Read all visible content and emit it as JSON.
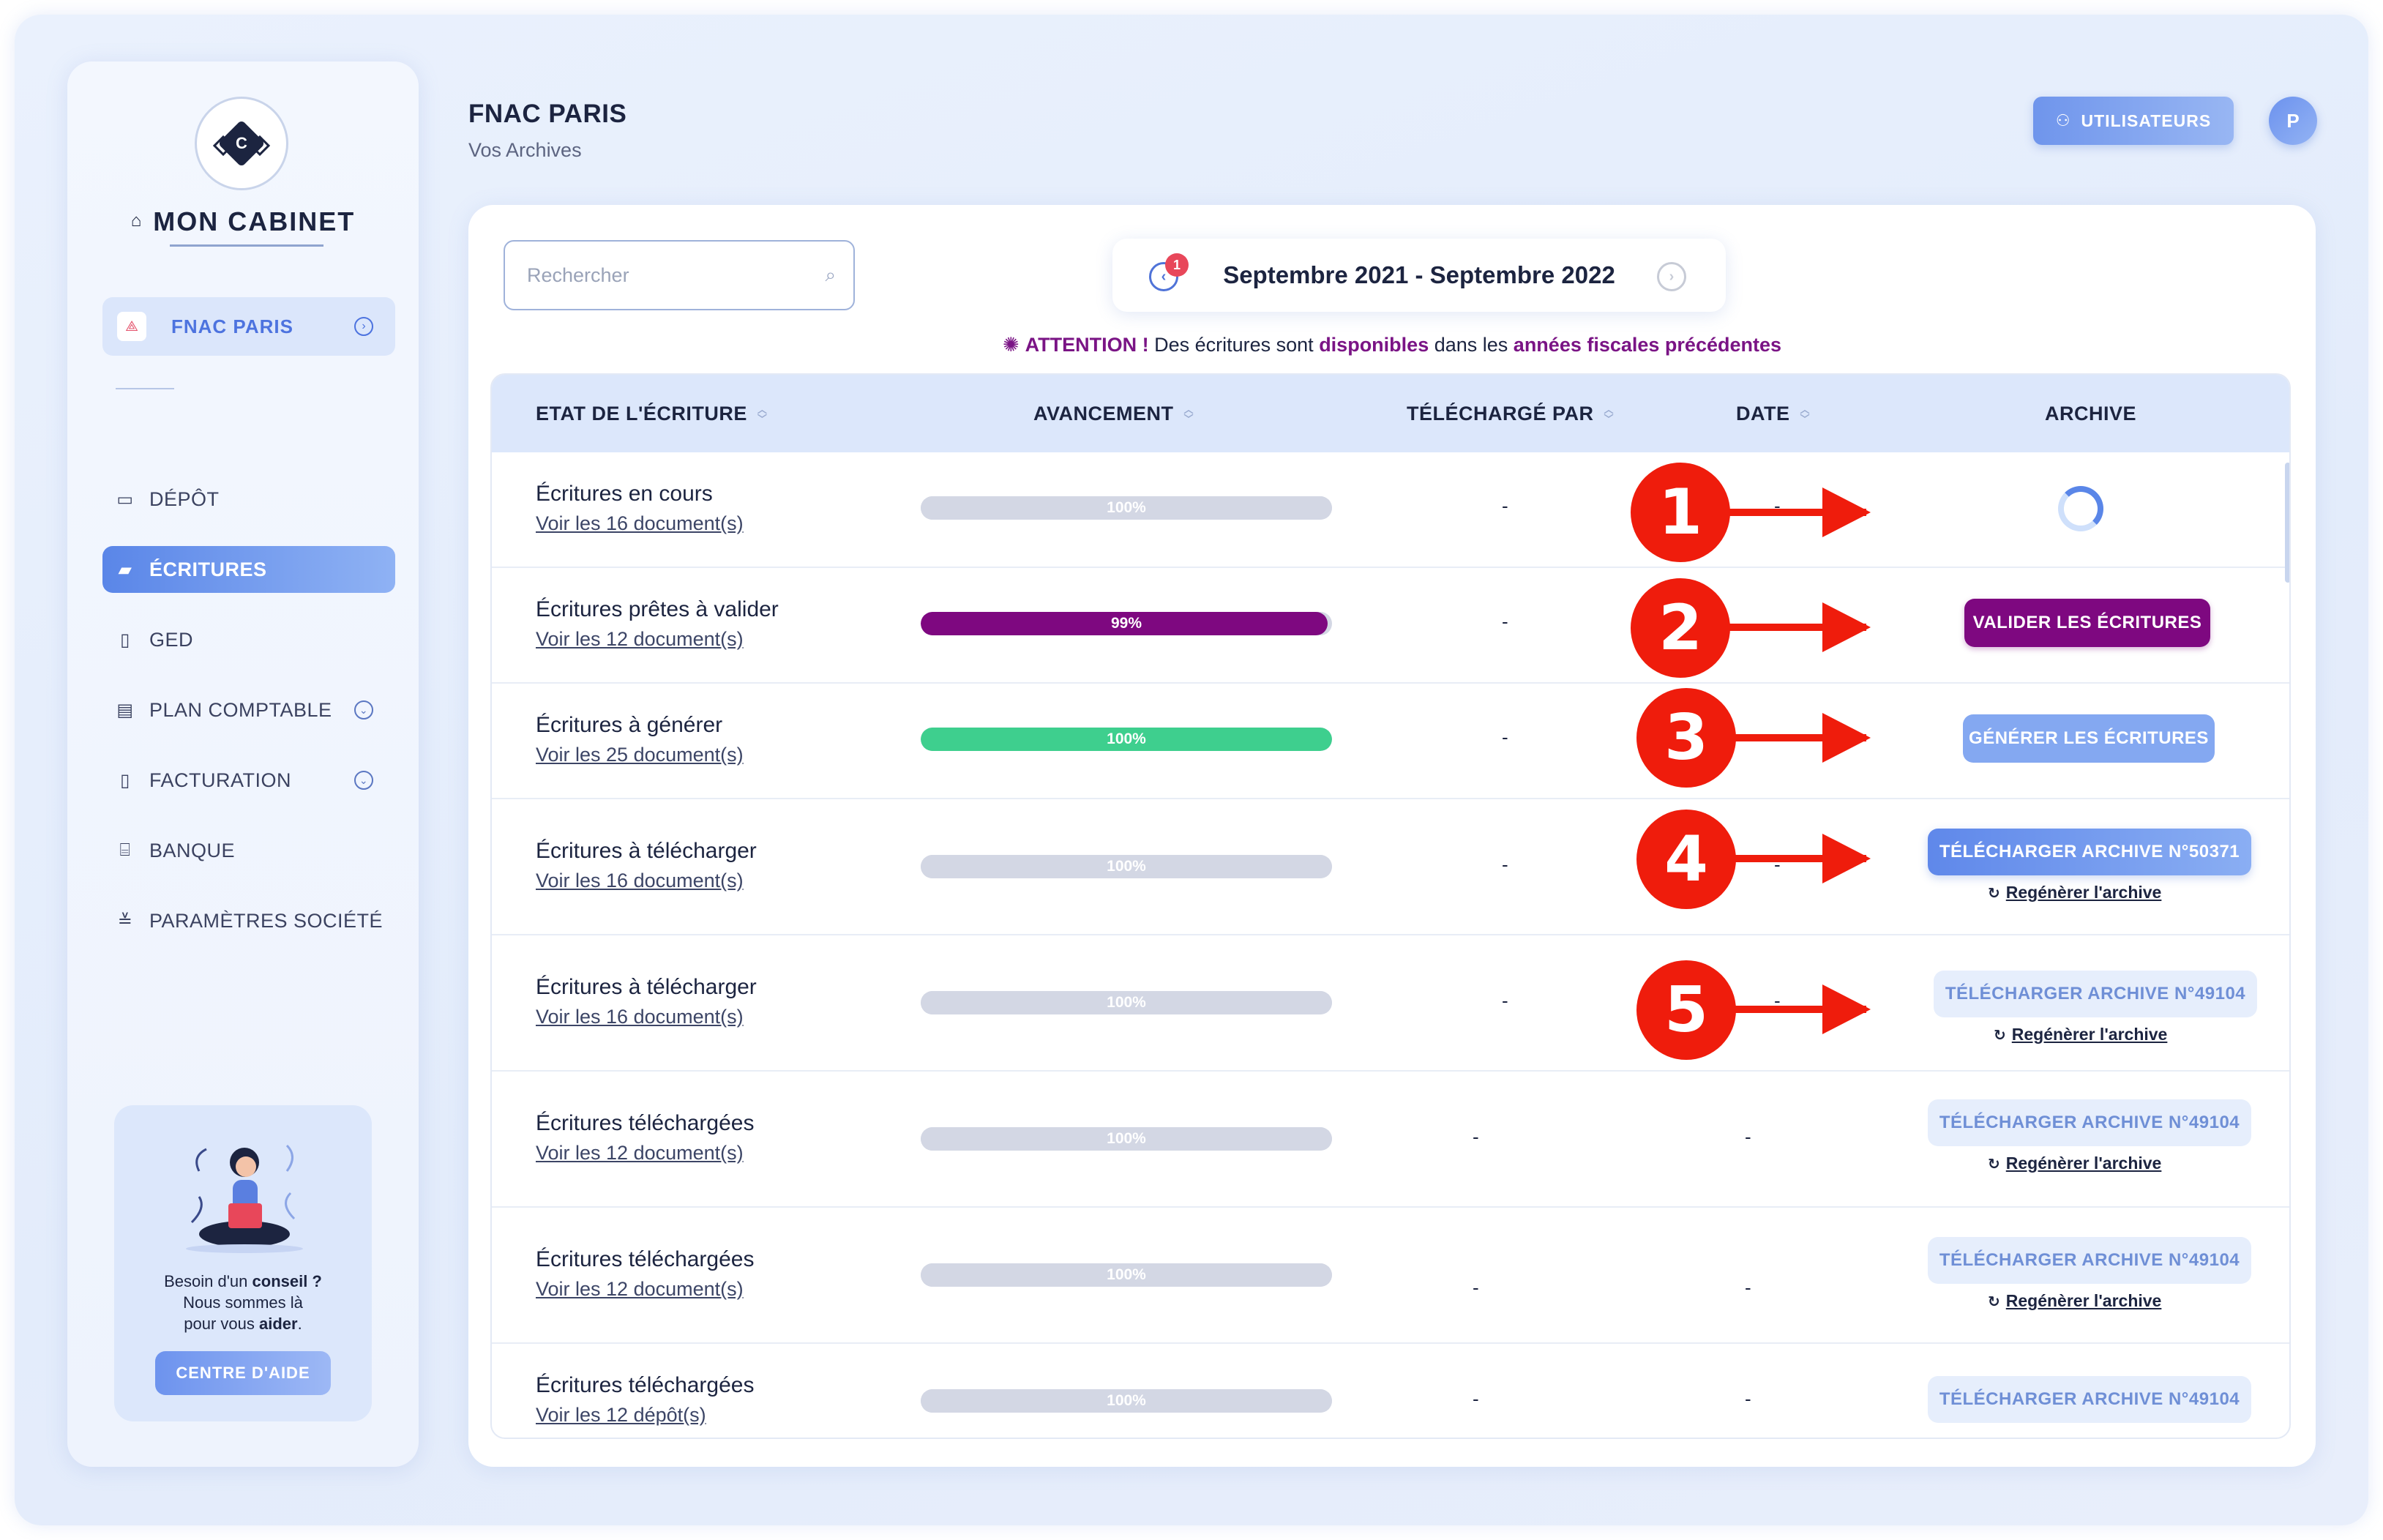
{
  "sidebar": {
    "logo_letter": "C",
    "brand": "MON CABINET",
    "company": "FNAC PARIS",
    "nav": [
      {
        "label": "DÉPÔT",
        "icon": "folder-icon"
      },
      {
        "label": "ÉCRITURES",
        "icon": "edit-folder-icon"
      },
      {
        "label": "GED",
        "icon": "document-icon"
      },
      {
        "label": "PLAN COMPTABLE",
        "icon": "ledger-icon"
      },
      {
        "label": "FACTURATION",
        "icon": "invoice-icon"
      },
      {
        "label": "BANQUE",
        "icon": "bank-icon"
      },
      {
        "label": "PARAMÈTRES SOCIÉTÉ",
        "icon": "sliders-icon"
      }
    ],
    "help": {
      "line1_pre": "Besoin d'un ",
      "line1_bold": "conseil ?",
      "line2": "Nous sommes là",
      "line3_pre": "pour vous ",
      "line3_bold": "aider",
      "line3_post": ".",
      "button": "CENTRE D'AIDE"
    }
  },
  "header": {
    "title": "FNAC PARIS",
    "subtitle": "Vos Archives",
    "users_button": "UTILISATEURS",
    "avatar_initial": "P"
  },
  "toolbar": {
    "search_placeholder": "Rechercher",
    "period": "Septembre 2021 - Septembre 2022",
    "period_badge": "1"
  },
  "attention": {
    "label": "ATTENTION !",
    "t1": " Des écritures sont ",
    "h1": "disponibles",
    "t2": " dans les ",
    "h2": "années fiscales précédentes"
  },
  "table": {
    "columns": [
      "ETAT DE L'ÉCRITURE",
      "AVANCEMENT",
      "TÉLÉCHARGÉ PAR",
      "DATE",
      "ARCHIVE"
    ],
    "rows": [
      {
        "title": "Écritures en cours",
        "link": "Voir les 16 document(s)",
        "progress": 100,
        "progress_label": "100%",
        "downloaded_by": "-",
        "date": "-",
        "archive": "spinner"
      },
      {
        "title": "Écritures prêtes à valider",
        "link": "Voir les 12 document(s)",
        "progress": 99,
        "progress_label": "99%",
        "downloaded_by": "-",
        "date": "",
        "archive_button": "VALIDER LES ÉCRITURES"
      },
      {
        "title": "Écritures à générer",
        "link": "Voir les 25 document(s)",
        "progress": 100,
        "progress_label": "100%",
        "downloaded_by": "-",
        "date": "",
        "archive_button": "GÉNÉRER LES ÉCRITURES"
      },
      {
        "title": "Écritures à télécharger",
        "link": "Voir les 16 document(s)",
        "progress": 100,
        "progress_label": "100%",
        "downloaded_by": "-",
        "date": "-",
        "archive_button": "TÉLÉCHARGER ARCHIVE N°50371",
        "regen": "Regénèrer l'archive"
      },
      {
        "title": "Écritures à télécharger",
        "link": "Voir les 16 document(s)",
        "progress": 100,
        "progress_label": "100%",
        "downloaded_by": "-",
        "date": "-",
        "archive_button": "TÉLÉCHARGER ARCHIVE N°49104",
        "regen": "Regénèrer l'archive"
      },
      {
        "title": "Écritures téléchargées",
        "link": "Voir les 12 document(s)",
        "progress": 100,
        "progress_label": "100%",
        "downloaded_by": "-",
        "date": "-",
        "archive_button": "TÉLÉCHARGER ARCHIVE N°49104",
        "regen": "Regénèrer l'archive"
      },
      {
        "title": "Écritures téléchargées",
        "link": "Voir les 12 document(s)",
        "progress": 100,
        "progress_label": "100%",
        "downloaded_by": "-",
        "date": "-",
        "archive_button": "TÉLÉCHARGER ARCHIVE N°49104",
        "regen": "Regénèrer l'archive"
      },
      {
        "title": "Écritures téléchargées",
        "link": "Voir les 12 dépôt(s)",
        "progress": 100,
        "progress_label": "100%",
        "downloaded_by": "-",
        "date": "-",
        "archive_button": "TÉLÉCHARGER ARCHIVE N°49104"
      }
    ]
  },
  "annotations": [
    "1",
    "2",
    "3",
    "4",
    "5"
  ],
  "colors": {
    "accent": "#5a86e8",
    "purple": "#7e0880",
    "green": "#3ecf8e",
    "annotation_red": "#ef1c0c",
    "bar_track": "#d3d7e4"
  }
}
